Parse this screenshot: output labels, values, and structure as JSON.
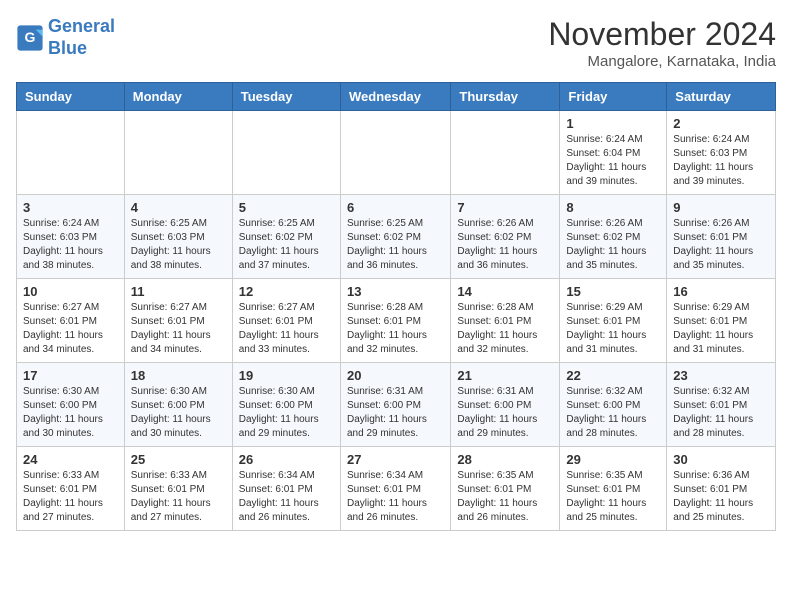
{
  "header": {
    "logo_line1": "General",
    "logo_line2": "Blue",
    "month_title": "November 2024",
    "location": "Mangalore, Karnataka, India"
  },
  "weekdays": [
    "Sunday",
    "Monday",
    "Tuesday",
    "Wednesday",
    "Thursday",
    "Friday",
    "Saturday"
  ],
  "weeks": [
    [
      {
        "day": "",
        "sunrise": "",
        "sunset": "",
        "daylight": ""
      },
      {
        "day": "",
        "sunrise": "",
        "sunset": "",
        "daylight": ""
      },
      {
        "day": "",
        "sunrise": "",
        "sunset": "",
        "daylight": ""
      },
      {
        "day": "",
        "sunrise": "",
        "sunset": "",
        "daylight": ""
      },
      {
        "day": "",
        "sunrise": "",
        "sunset": "",
        "daylight": ""
      },
      {
        "day": "1",
        "sunrise": "Sunrise: 6:24 AM",
        "sunset": "Sunset: 6:04 PM",
        "daylight": "Daylight: 11 hours and 39 minutes."
      },
      {
        "day": "2",
        "sunrise": "Sunrise: 6:24 AM",
        "sunset": "Sunset: 6:03 PM",
        "daylight": "Daylight: 11 hours and 39 minutes."
      }
    ],
    [
      {
        "day": "3",
        "sunrise": "Sunrise: 6:24 AM",
        "sunset": "Sunset: 6:03 PM",
        "daylight": "Daylight: 11 hours and 38 minutes."
      },
      {
        "day": "4",
        "sunrise": "Sunrise: 6:25 AM",
        "sunset": "Sunset: 6:03 PM",
        "daylight": "Daylight: 11 hours and 38 minutes."
      },
      {
        "day": "5",
        "sunrise": "Sunrise: 6:25 AM",
        "sunset": "Sunset: 6:02 PM",
        "daylight": "Daylight: 11 hours and 37 minutes."
      },
      {
        "day": "6",
        "sunrise": "Sunrise: 6:25 AM",
        "sunset": "Sunset: 6:02 PM",
        "daylight": "Daylight: 11 hours and 36 minutes."
      },
      {
        "day": "7",
        "sunrise": "Sunrise: 6:26 AM",
        "sunset": "Sunset: 6:02 PM",
        "daylight": "Daylight: 11 hours and 36 minutes."
      },
      {
        "day": "8",
        "sunrise": "Sunrise: 6:26 AM",
        "sunset": "Sunset: 6:02 PM",
        "daylight": "Daylight: 11 hours and 35 minutes."
      },
      {
        "day": "9",
        "sunrise": "Sunrise: 6:26 AM",
        "sunset": "Sunset: 6:01 PM",
        "daylight": "Daylight: 11 hours and 35 minutes."
      }
    ],
    [
      {
        "day": "10",
        "sunrise": "Sunrise: 6:27 AM",
        "sunset": "Sunset: 6:01 PM",
        "daylight": "Daylight: 11 hours and 34 minutes."
      },
      {
        "day": "11",
        "sunrise": "Sunrise: 6:27 AM",
        "sunset": "Sunset: 6:01 PM",
        "daylight": "Daylight: 11 hours and 34 minutes."
      },
      {
        "day": "12",
        "sunrise": "Sunrise: 6:27 AM",
        "sunset": "Sunset: 6:01 PM",
        "daylight": "Daylight: 11 hours and 33 minutes."
      },
      {
        "day": "13",
        "sunrise": "Sunrise: 6:28 AM",
        "sunset": "Sunset: 6:01 PM",
        "daylight": "Daylight: 11 hours and 32 minutes."
      },
      {
        "day": "14",
        "sunrise": "Sunrise: 6:28 AM",
        "sunset": "Sunset: 6:01 PM",
        "daylight": "Daylight: 11 hours and 32 minutes."
      },
      {
        "day": "15",
        "sunrise": "Sunrise: 6:29 AM",
        "sunset": "Sunset: 6:01 PM",
        "daylight": "Daylight: 11 hours and 31 minutes."
      },
      {
        "day": "16",
        "sunrise": "Sunrise: 6:29 AM",
        "sunset": "Sunset: 6:01 PM",
        "daylight": "Daylight: 11 hours and 31 minutes."
      }
    ],
    [
      {
        "day": "17",
        "sunrise": "Sunrise: 6:30 AM",
        "sunset": "Sunset: 6:00 PM",
        "daylight": "Daylight: 11 hours and 30 minutes."
      },
      {
        "day": "18",
        "sunrise": "Sunrise: 6:30 AM",
        "sunset": "Sunset: 6:00 PM",
        "daylight": "Daylight: 11 hours and 30 minutes."
      },
      {
        "day": "19",
        "sunrise": "Sunrise: 6:30 AM",
        "sunset": "Sunset: 6:00 PM",
        "daylight": "Daylight: 11 hours and 29 minutes."
      },
      {
        "day": "20",
        "sunrise": "Sunrise: 6:31 AM",
        "sunset": "Sunset: 6:00 PM",
        "daylight": "Daylight: 11 hours and 29 minutes."
      },
      {
        "day": "21",
        "sunrise": "Sunrise: 6:31 AM",
        "sunset": "Sunset: 6:00 PM",
        "daylight": "Daylight: 11 hours and 29 minutes."
      },
      {
        "day": "22",
        "sunrise": "Sunrise: 6:32 AM",
        "sunset": "Sunset: 6:00 PM",
        "daylight": "Daylight: 11 hours and 28 minutes."
      },
      {
        "day": "23",
        "sunrise": "Sunrise: 6:32 AM",
        "sunset": "Sunset: 6:01 PM",
        "daylight": "Daylight: 11 hours and 28 minutes."
      }
    ],
    [
      {
        "day": "24",
        "sunrise": "Sunrise: 6:33 AM",
        "sunset": "Sunset: 6:01 PM",
        "daylight": "Daylight: 11 hours and 27 minutes."
      },
      {
        "day": "25",
        "sunrise": "Sunrise: 6:33 AM",
        "sunset": "Sunset: 6:01 PM",
        "daylight": "Daylight: 11 hours and 27 minutes."
      },
      {
        "day": "26",
        "sunrise": "Sunrise: 6:34 AM",
        "sunset": "Sunset: 6:01 PM",
        "daylight": "Daylight: 11 hours and 26 minutes."
      },
      {
        "day": "27",
        "sunrise": "Sunrise: 6:34 AM",
        "sunset": "Sunset: 6:01 PM",
        "daylight": "Daylight: 11 hours and 26 minutes."
      },
      {
        "day": "28",
        "sunrise": "Sunrise: 6:35 AM",
        "sunset": "Sunset: 6:01 PM",
        "daylight": "Daylight: 11 hours and 26 minutes."
      },
      {
        "day": "29",
        "sunrise": "Sunrise: 6:35 AM",
        "sunset": "Sunset: 6:01 PM",
        "daylight": "Daylight: 11 hours and 25 minutes."
      },
      {
        "day": "30",
        "sunrise": "Sunrise: 6:36 AM",
        "sunset": "Sunset: 6:01 PM",
        "daylight": "Daylight: 11 hours and 25 minutes."
      }
    ]
  ]
}
